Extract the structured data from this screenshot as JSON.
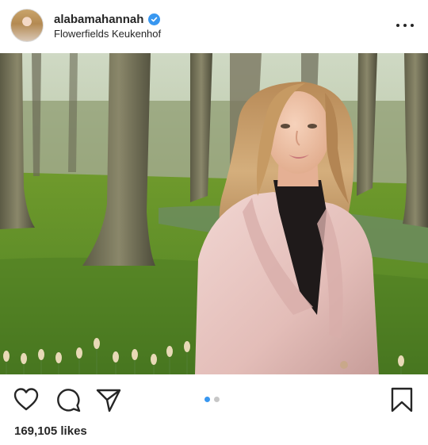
{
  "post": {
    "username": "alabamahannah",
    "verified": true,
    "location": "Flowerfields Keukenhof",
    "likes_text": "169,105 likes"
  },
  "icons": {
    "verified": "verified-badge-icon",
    "more": "more-options-icon",
    "like": "heart-icon",
    "comment": "comment-icon",
    "share": "paper-plane-icon",
    "save": "bookmark-icon"
  },
  "carousel": {
    "total": 2,
    "active_index": 0
  },
  "colors": {
    "text": "#262626",
    "verified_blue": "#3897f0",
    "dot_active": "#3897f0",
    "dot_inactive": "#c7c7c7"
  }
}
